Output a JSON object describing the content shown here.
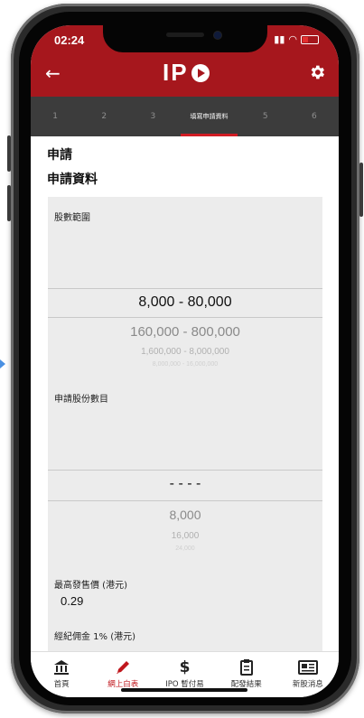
{
  "status_bar": {
    "time": "02:24",
    "signal": "..l",
    "wifi": "wifi"
  },
  "header": {
    "logo_text": "IP",
    "back_icon": "arrow-left-icon",
    "settings_icon": "gear-icon",
    "brand_color": "#a6171d"
  },
  "steps": [
    {
      "label": "1"
    },
    {
      "label": "2"
    },
    {
      "label": "3"
    },
    {
      "label": "填寫申請資料",
      "active": true
    },
    {
      "label": "5"
    },
    {
      "label": "6"
    }
  ],
  "main": {
    "title": "申請",
    "subtitle": "申請資料",
    "share_range": {
      "label": "股數範圍",
      "options": [
        "8,000 - 80,000",
        "160,000 - 800,000",
        "1,600,000 - 8,000,000",
        "8,000,000 - 16,000,000"
      ]
    },
    "shares_applied": {
      "label": "申請股份數目",
      "options": [
        "- - - -",
        "8,000",
        "16,000",
        "24,000"
      ]
    },
    "max_price": {
      "label": "最高發售價 (港元)",
      "value": "0.29"
    },
    "brokerage": {
      "label": "經紀佣金 1% (港元)"
    }
  },
  "tabbar": [
    {
      "label": "首頁",
      "icon": "bank-icon"
    },
    {
      "label": "網上白表",
      "icon": "pencil-icon",
      "active": true
    },
    {
      "label": "IPO 暫付易",
      "icon": "dollar-icon"
    },
    {
      "label": "配發結果",
      "icon": "clipboard-icon"
    },
    {
      "label": "新股消息",
      "icon": "newspaper-icon"
    }
  ]
}
